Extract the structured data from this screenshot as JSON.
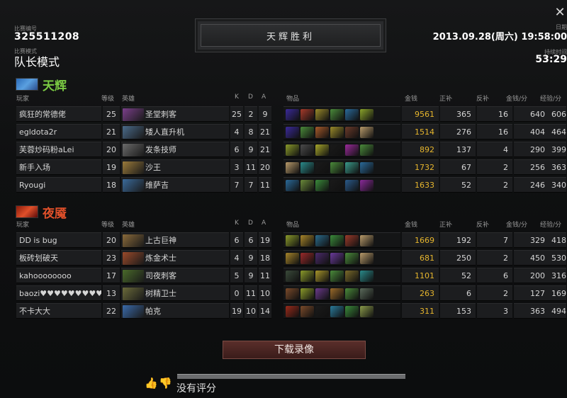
{
  "header": {
    "match_id_label": "比赛编号",
    "match_id": "325511208",
    "mode_label": "比赛模式",
    "mode": "队长模式",
    "date_label": "日期",
    "date": "2013.09.28(周六) 19:58:00",
    "duration_label": "持续时间",
    "duration": "53:29",
    "result": "天辉胜利"
  },
  "columns": {
    "player": "玩家",
    "level": "等级",
    "hero": "英雄",
    "k": "K",
    "d": "D",
    "a": "A",
    "items": "物品",
    "gold": "金钱",
    "last_hits": "正补",
    "denies": "反补",
    "gpm": "金钱/分",
    "xpm": "经验/分"
  },
  "colors": {
    "radiant": "#7ac943",
    "dire": "#e0502a",
    "gold": "#e6b52d"
  },
  "radiant": {
    "name": "天辉",
    "players": [
      {
        "player": "疯狂的常德佬",
        "level": "25",
        "hero": "圣堂刺客",
        "k": "25",
        "d": "2",
        "a": "9",
        "gold": "9561",
        "lh": "365",
        "dn": "16",
        "gpm": "640",
        "xpm": "606",
        "portrait": "#7a3f8a",
        "items": [
          "#3a2a9a",
          "#a63a2a",
          "#9a8a2a",
          "#4a8a3a",
          "#2a6a9a",
          "#8aa42a"
        ]
      },
      {
        "player": "egldota2r",
        "level": "21",
        "hero": "矮人直升机",
        "k": "4",
        "d": "8",
        "a": "21",
        "gold": "1514",
        "lh": "276",
        "dn": "16",
        "gpm": "404",
        "xpm": "464",
        "portrait": "#4a6a8a",
        "items": [
          "#3a2a9a",
          "#4a8a3a",
          "#a65a2a",
          "#9a8a2a",
          "#6a3a2a",
          "#b89a6a"
        ]
      },
      {
        "player": "芙蓉炒码粉aLei",
        "level": "20",
        "hero": "发条技师",
        "k": "6",
        "d": "9",
        "a": "21",
        "gold": "892",
        "lh": "137",
        "dn": "4",
        "gpm": "290",
        "xpm": "399",
        "portrait": "#6a6a6a",
        "items": [
          "#8a9a2a",
          "#4a4a4a",
          "#a6a62a",
          "#1a1a1a",
          "#9a2a9a",
          "#4a8a3a"
        ]
      },
      {
        "player": "新手入场",
        "level": "19",
        "hero": "沙王",
        "k": "3",
        "d": "11",
        "a": "20",
        "gold": "1732",
        "lh": "67",
        "dn": "2",
        "gpm": "256",
        "xpm": "363",
        "portrait": "#9a7a3a",
        "items": [
          "#b89a6a",
          "#2a8a8a",
          "#1a1a1a",
          "#4a8a3a",
          "#3a9a8a",
          "#2a6a9a"
        ]
      },
      {
        "player": "Ryougi",
        "level": "18",
        "hero": "维萨吉",
        "k": "7",
        "d": "7",
        "a": "11",
        "gold": "1633",
        "lh": "52",
        "dn": "2",
        "gpm": "246",
        "xpm": "340",
        "portrait": "#3a6a9a",
        "items": [
          "#2a6a9a",
          "#6a8a3a",
          "#3a8a3a",
          "#1a1a1a",
          "#2a5a8a",
          "#8a2a9a"
        ]
      }
    ]
  },
  "dire": {
    "name": "夜魇",
    "players": [
      {
        "player": "DD is bug",
        "level": "20",
        "hero": "上古巨神",
        "k": "6",
        "d": "6",
        "a": "19",
        "gold": "1669",
        "lh": "192",
        "dn": "7",
        "gpm": "329",
        "xpm": "418",
        "portrait": "#8a6a3a",
        "items": [
          "#8a9a2a",
          "#a6842a",
          "#2a6a8a",
          "#3a8a3a",
          "#9a3a2a",
          "#b89a6a"
        ]
      },
      {
        "player": "板砖划破天",
        "level": "23",
        "hero": "炼金术士",
        "k": "4",
        "d": "9",
        "a": "18",
        "gold": "681",
        "lh": "250",
        "dn": "2",
        "gpm": "450",
        "xpm": "530",
        "portrait": "#9a4a2a",
        "items": [
          "#a6842a",
          "#9a2a2a",
          "#4a2a6a",
          "#6a3a9a",
          "#4a8a3a",
          "#b89a6a"
        ]
      },
      {
        "player": "kahoooooooo",
        "level": "17",
        "hero": "司夜刺客",
        "k": "5",
        "d": "9",
        "a": "11",
        "gold": "1101",
        "lh": "52",
        "dn": "6",
        "gpm": "200",
        "xpm": "316",
        "portrait": "#4a6a2a",
        "items": [
          "#3a4a3a",
          "#8a9a2a",
          "#a6942a",
          "#4a8a3a",
          "#7a6a2a",
          "#2a8a8a"
        ]
      },
      {
        "player": "baozi♥♥♥♥♥♥♥♥♥",
        "level": "13",
        "hero": "树精卫士",
        "k": "0",
        "d": "11",
        "a": "10",
        "gold": "263",
        "lh": "6",
        "dn": "2",
        "gpm": "127",
        "xpm": "169",
        "portrait": "#6a6a3a",
        "items": [
          "#7a4a2a",
          "#8a9a2a",
          "#6a3a8a",
          "#9a6a2a",
          "#4a8a3a",
          "#5a6a5a"
        ]
      },
      {
        "player": "不卡大大",
        "level": "22",
        "hero": "帕克",
        "k": "19",
        "d": "10",
        "a": "14",
        "gold": "311",
        "lh": "153",
        "dn": "3",
        "gpm": "363",
        "xpm": "494",
        "portrait": "#3a6aaa",
        "items": [
          "#9a2a1a",
          "#7a4a2a",
          "#1a1a1a",
          "#2a7a9a",
          "#3a8a3a",
          "#8a9a4a"
        ]
      }
    ]
  },
  "footer": {
    "download": "下载录像",
    "no_rating": "没有评分"
  },
  "icons": {
    "close": "close-icon",
    "thumb_up": "thumb-up-icon",
    "thumb_down": "thumb-down-icon"
  }
}
